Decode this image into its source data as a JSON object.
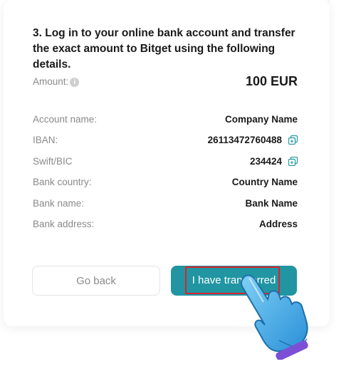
{
  "instruction": "3. Log in to your online bank account and transfer the exact amount to Bitget using the following details.",
  "amount": {
    "label": "Amount:",
    "value": "100 EUR"
  },
  "details": {
    "account_name": {
      "label": "Account name:",
      "value": "Company Name"
    },
    "iban": {
      "label": "IBAN:",
      "value": "26113472760488"
    },
    "swift": {
      "label": "Swift/BIC",
      "value": "234424"
    },
    "bank_country": {
      "label": "Bank country:",
      "value": "Country Name"
    },
    "bank_name": {
      "label": "Bank name:",
      "value": "Bank Name"
    },
    "bank_address": {
      "label": "Bank address:",
      "value": "Address"
    }
  },
  "buttons": {
    "back": "Go back",
    "transferred": "I have transferred"
  },
  "colors": {
    "accent": "#2196a2",
    "highlight": "#d9232d",
    "hand": "#3aa9e6",
    "cuff": "#7b4fd6"
  },
  "icons": [
    "info-icon",
    "copy-icon",
    "pointing-hand-icon"
  ]
}
